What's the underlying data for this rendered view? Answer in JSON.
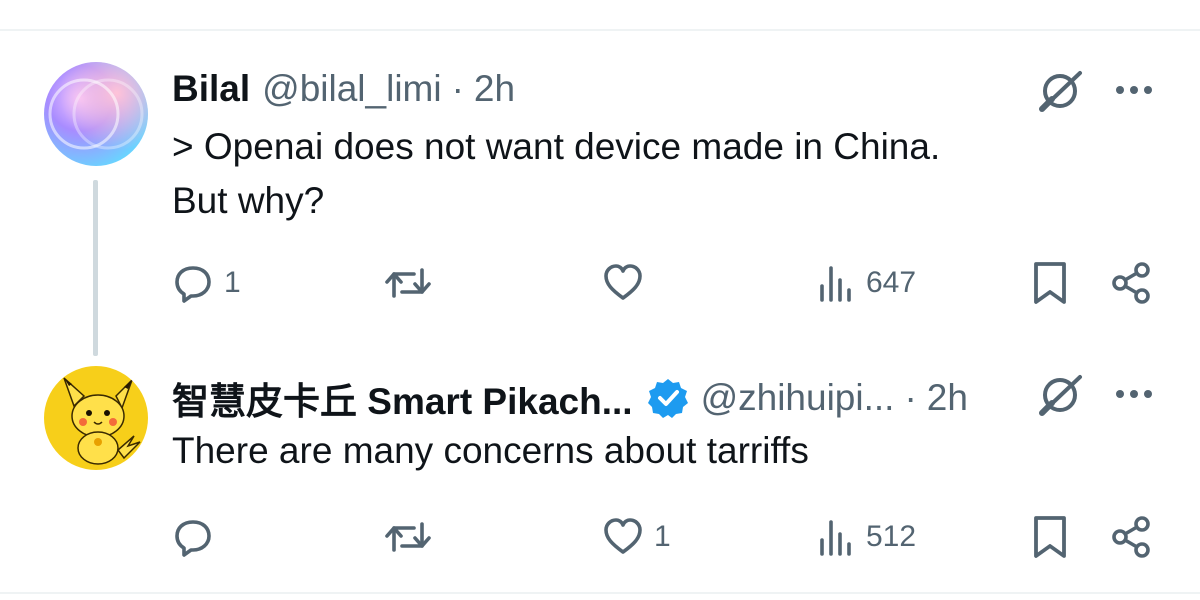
{
  "tweets": [
    {
      "author_name": "Bilal",
      "handle": "@bilal_limi",
      "separator": "·",
      "time": "2h",
      "verified": false,
      "text_lines": [
        "> Openai does not want device made in China.",
        "But why?"
      ],
      "actions": {
        "reply_count": "1",
        "retweet_count": "",
        "like_count": "",
        "views_count": "647"
      }
    },
    {
      "author_name": "智慧皮卡丘 Smart Pikach...",
      "handle": "@zhihuipi...",
      "separator": "·",
      "time": "2h",
      "verified": true,
      "text_lines": [
        "There are many concerns about tarriffs"
      ],
      "actions": {
        "reply_count": "",
        "retweet_count": "",
        "like_count": "1",
        "views_count": "512"
      }
    }
  ],
  "icons": {
    "grok": "grok-icon",
    "more": "more-icon",
    "reply": "reply-icon",
    "retweet": "retweet-icon",
    "like": "like-icon",
    "views": "views-icon",
    "bookmark": "bookmark-icon",
    "share": "share-icon",
    "verified": "verified-badge-icon"
  },
  "colors": {
    "text": "#0f1419",
    "secondary": "#536471",
    "verified": "#1d9bf0",
    "divider": "#eff3f4",
    "thread_line": "#cfd9de"
  }
}
